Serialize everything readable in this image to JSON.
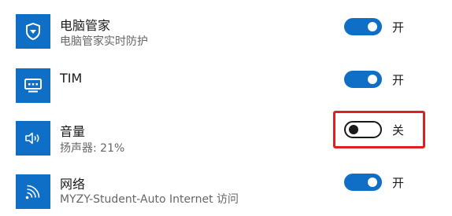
{
  "colors": {
    "accent": "#0f6fc6",
    "highlight": "#e02020"
  },
  "items": [
    {
      "icon": "shield-icon",
      "title": "电脑管家",
      "subtitle": "电脑管家实时防护",
      "toggle_on": true,
      "state_label": "开"
    },
    {
      "icon": "chat-icon",
      "title": "TIM",
      "subtitle": "",
      "toggle_on": true,
      "state_label": "开"
    },
    {
      "icon": "speaker-icon",
      "title": "音量",
      "subtitle": "扬声器: 21%",
      "toggle_on": false,
      "state_label": "关"
    },
    {
      "icon": "wifi-icon",
      "title": "网络",
      "subtitle": "MYZY-Student-Auto Internet 访问",
      "toggle_on": true,
      "state_label": "开"
    }
  ]
}
